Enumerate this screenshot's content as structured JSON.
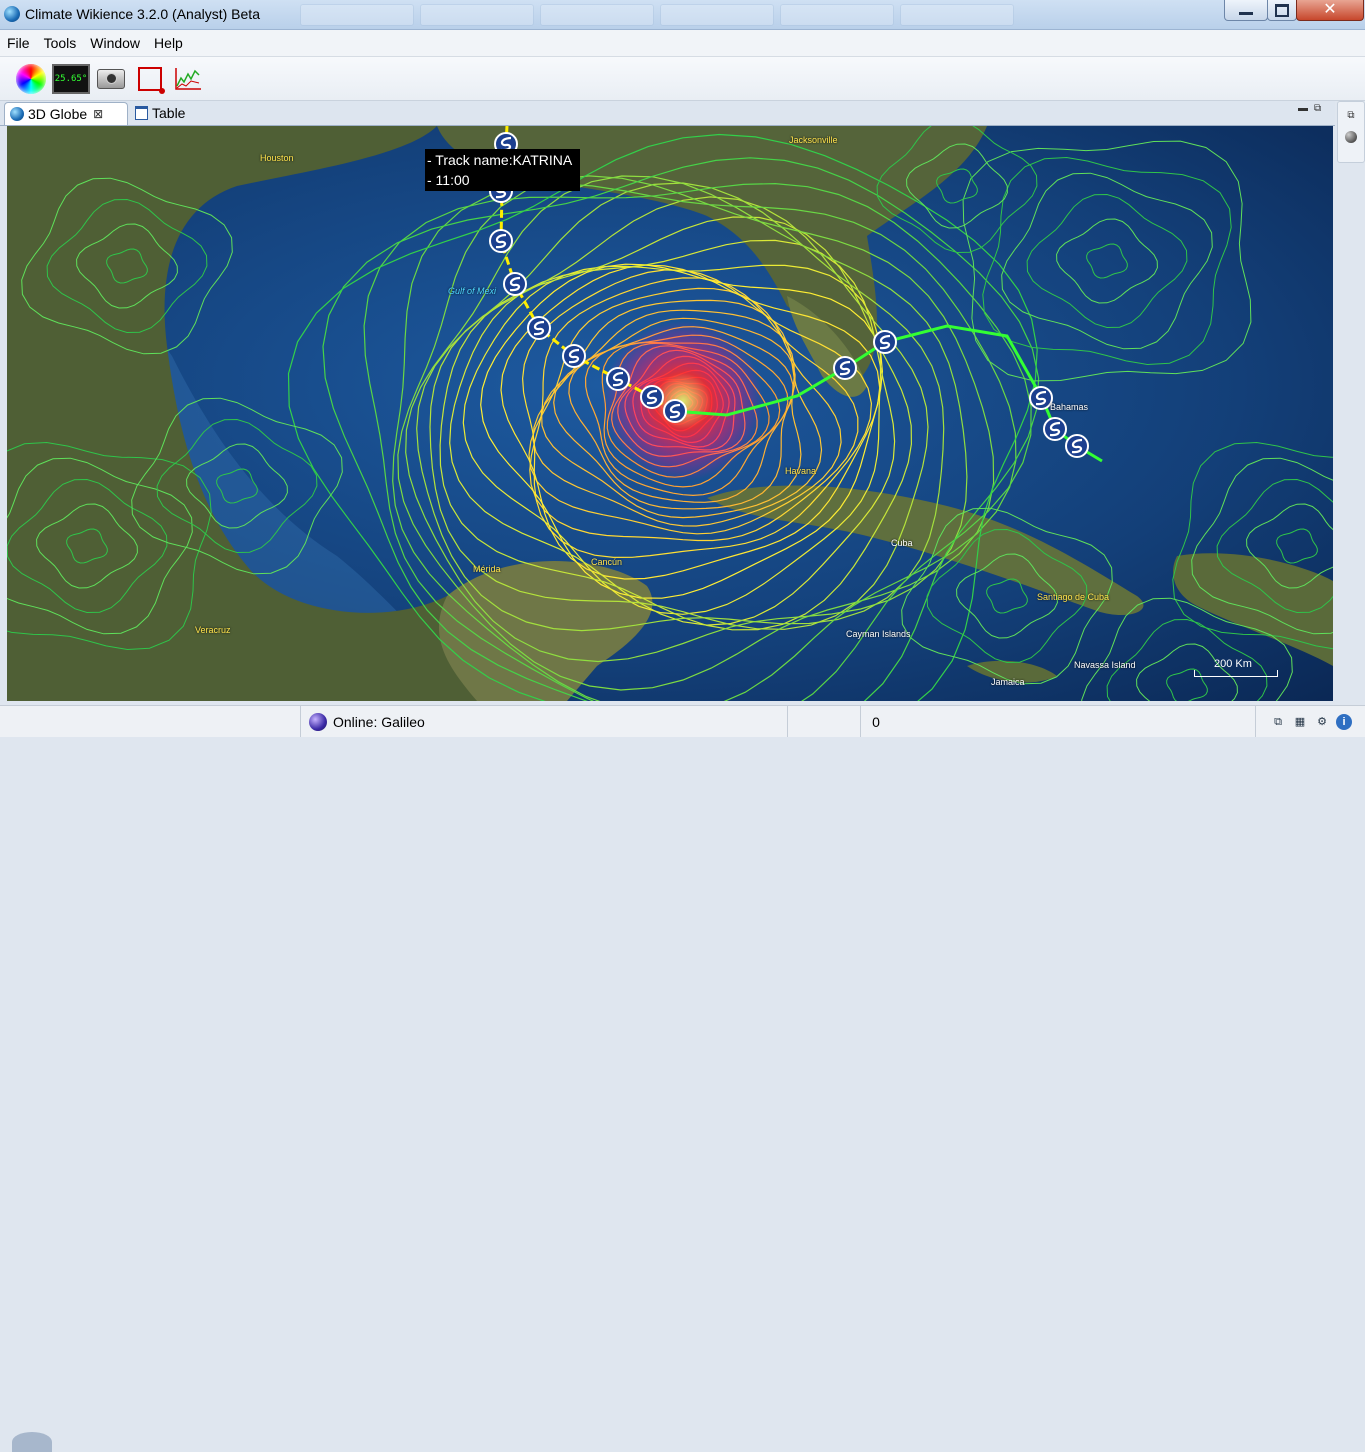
{
  "window": {
    "title": "Climate Wikience 3.2.0 (Analyst) Beta"
  },
  "menu": [
    {
      "id": "file",
      "label": "File"
    },
    {
      "id": "tools",
      "label": "Tools"
    },
    {
      "id": "window",
      "label": "Window"
    },
    {
      "id": "help",
      "label": "Help"
    }
  ],
  "toolbar": {
    "temperature_display": "25.65°"
  },
  "tabs": [
    {
      "id": "globe",
      "label": "3D Globe"
    },
    {
      "id": "table",
      "label": "Table"
    }
  ],
  "globe": {
    "tooltip": {
      "line1": "- Track name:KATRINA",
      "line2": "- 11:00"
    },
    "places": {
      "houston": "Houston",
      "jacksonville": "Jacksonville",
      "gulf": "Gulf of Mexi",
      "havana": "Havana",
      "bahamas": "Bahamas",
      "cuba": "Cuba",
      "merida": "Mérida",
      "cancun": "Cancún",
      "santiago": "Santiago de Cuba",
      "veracruz": "Veracruz",
      "cayman": "Cayman Islands",
      "navassa": "Navassa Island",
      "jamaica": "Jamaica"
    },
    "scale": "200 Km",
    "colors": {
      "track_west": "#ffee00",
      "track_east": "#33ff33",
      "contour_low": "#32d04a",
      "contour_high": "#ff1aa0"
    }
  },
  "status": {
    "connection": "Online: Galileo",
    "count": "0"
  }
}
